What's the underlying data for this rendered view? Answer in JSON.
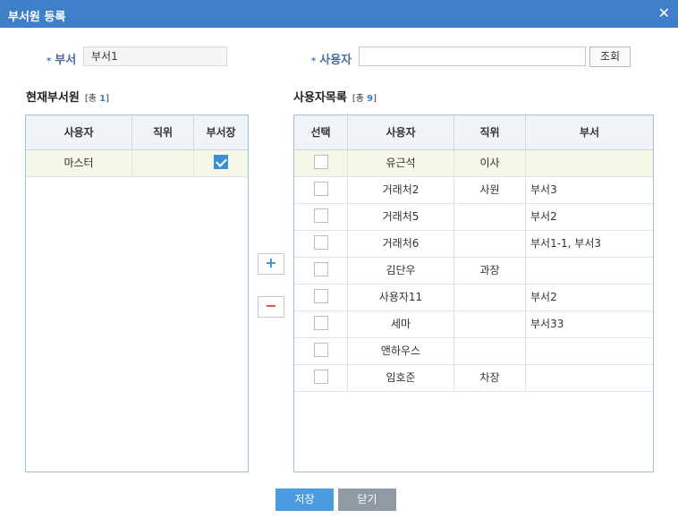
{
  "window": {
    "title": "부서원 등록",
    "close_glyph": "✕"
  },
  "form": {
    "dept_label": "부서",
    "dept_value": "부서1",
    "user_label": "사용자",
    "user_value": "",
    "search_button": "조회"
  },
  "current": {
    "title": "현재부서원",
    "count_prefix": "[총",
    "count": "1",
    "count_suffix": "]",
    "columns": [
      "사용자",
      "직위",
      "부서장"
    ],
    "rows": [
      {
        "user": "마스터",
        "position": "",
        "is_head": true
      }
    ]
  },
  "users": {
    "title": "사용자목록",
    "count_prefix": "[총",
    "count": "9",
    "count_suffix": "]",
    "columns": [
      "선택",
      "사용자",
      "직위",
      "부서"
    ],
    "rows": [
      {
        "user": "유근석",
        "position": "이사",
        "dept": ""
      },
      {
        "user": "거래처2",
        "position": "사원",
        "dept": "부서3"
      },
      {
        "user": "거래처5",
        "position": "",
        "dept": "부서2"
      },
      {
        "user": "거래처6",
        "position": "",
        "dept": "부서1-1, 부서3"
      },
      {
        "user": "김단우",
        "position": "과장",
        "dept": ""
      },
      {
        "user": "사용자11",
        "position": "",
        "dept": "부서2"
      },
      {
        "user": "세마",
        "position": "",
        "dept": "부서33"
      },
      {
        "user": "앤하우스",
        "position": "",
        "dept": ""
      },
      {
        "user": "임호준",
        "position": "차장",
        "dept": ""
      }
    ]
  },
  "move": {
    "add": "+",
    "remove": "−"
  },
  "footer": {
    "save": "저장",
    "close": "닫기"
  },
  "colors": {
    "accent": "#3d7fc9",
    "save_bg": "#4a9be0",
    "close_bg": "#8f9aa5",
    "row_selected": "#f4f8e6"
  }
}
